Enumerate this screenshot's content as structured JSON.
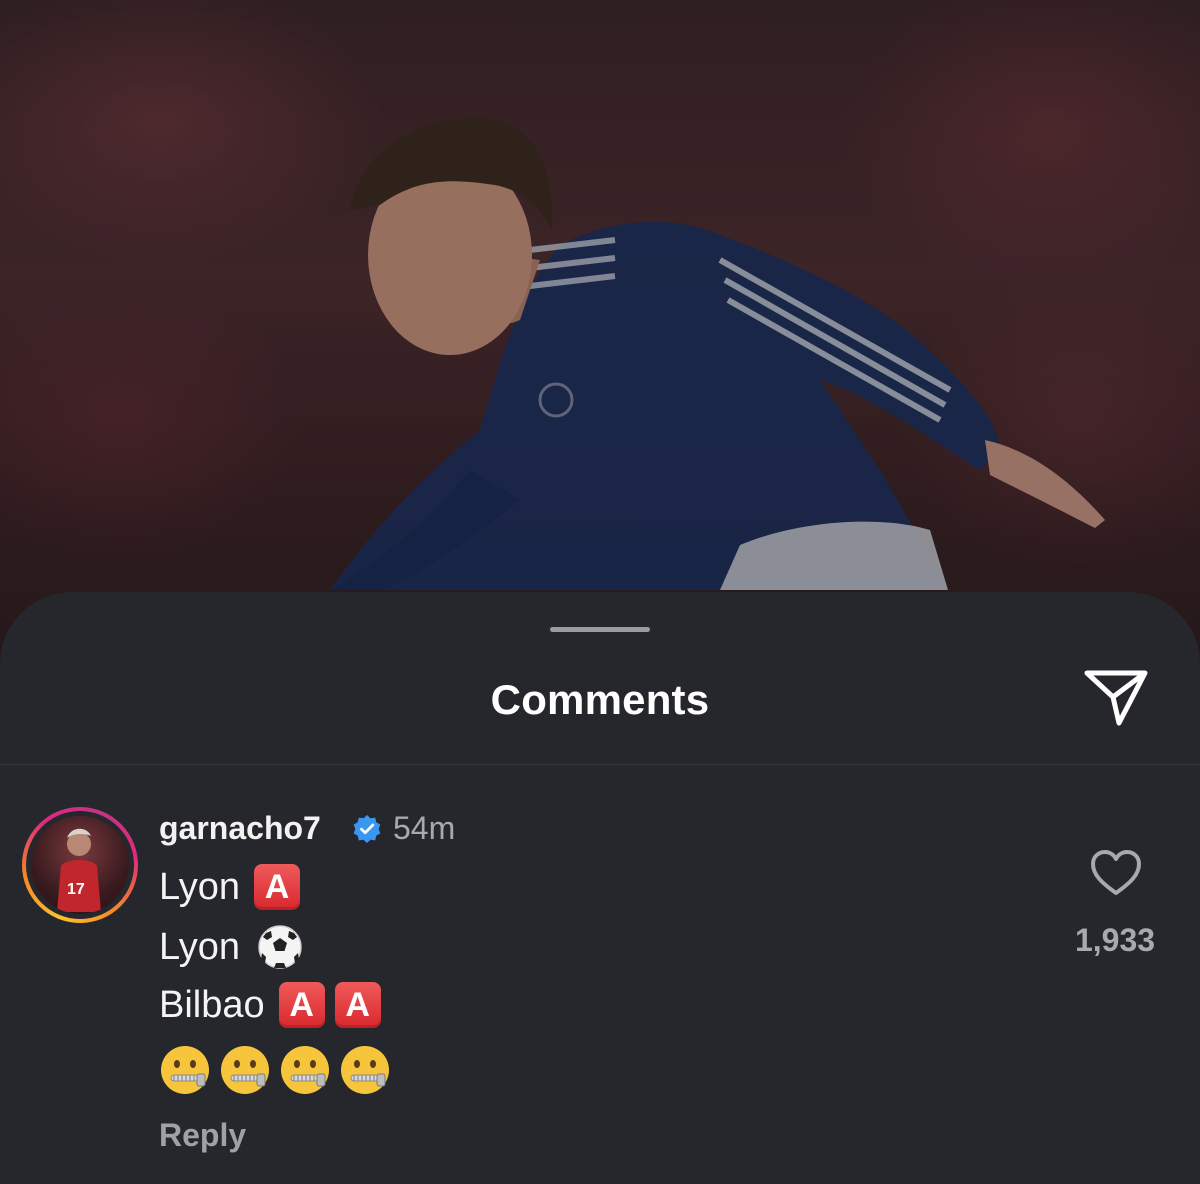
{
  "sheet": {
    "title": "Comments",
    "share_icon": "send-icon"
  },
  "comment": {
    "username": "garnacho7",
    "verified": true,
    "time": "54m",
    "lines": [
      {
        "text": "Lyon",
        "emoji": [
          "red-A-button"
        ]
      },
      {
        "text": "Lyon",
        "emoji": [
          "soccer-ball"
        ]
      },
      {
        "text": "Bilbao",
        "emoji": [
          "red-A-button",
          "red-A-button"
        ]
      },
      {
        "text": "",
        "emoji": [
          "zipper-mouth-face",
          "zipper-mouth-face",
          "zipper-mouth-face",
          "zipper-mouth-face"
        ]
      }
    ],
    "emoji_A_label": "A",
    "reply_label": "Reply",
    "like_count": "1,933",
    "avatar_jersey_number": "17"
  },
  "colors": {
    "sheet_bg": "#25272c",
    "verified_blue": "#3897f0",
    "text_primary": "#f2f2f3",
    "text_secondary": "#a7a9b0"
  }
}
